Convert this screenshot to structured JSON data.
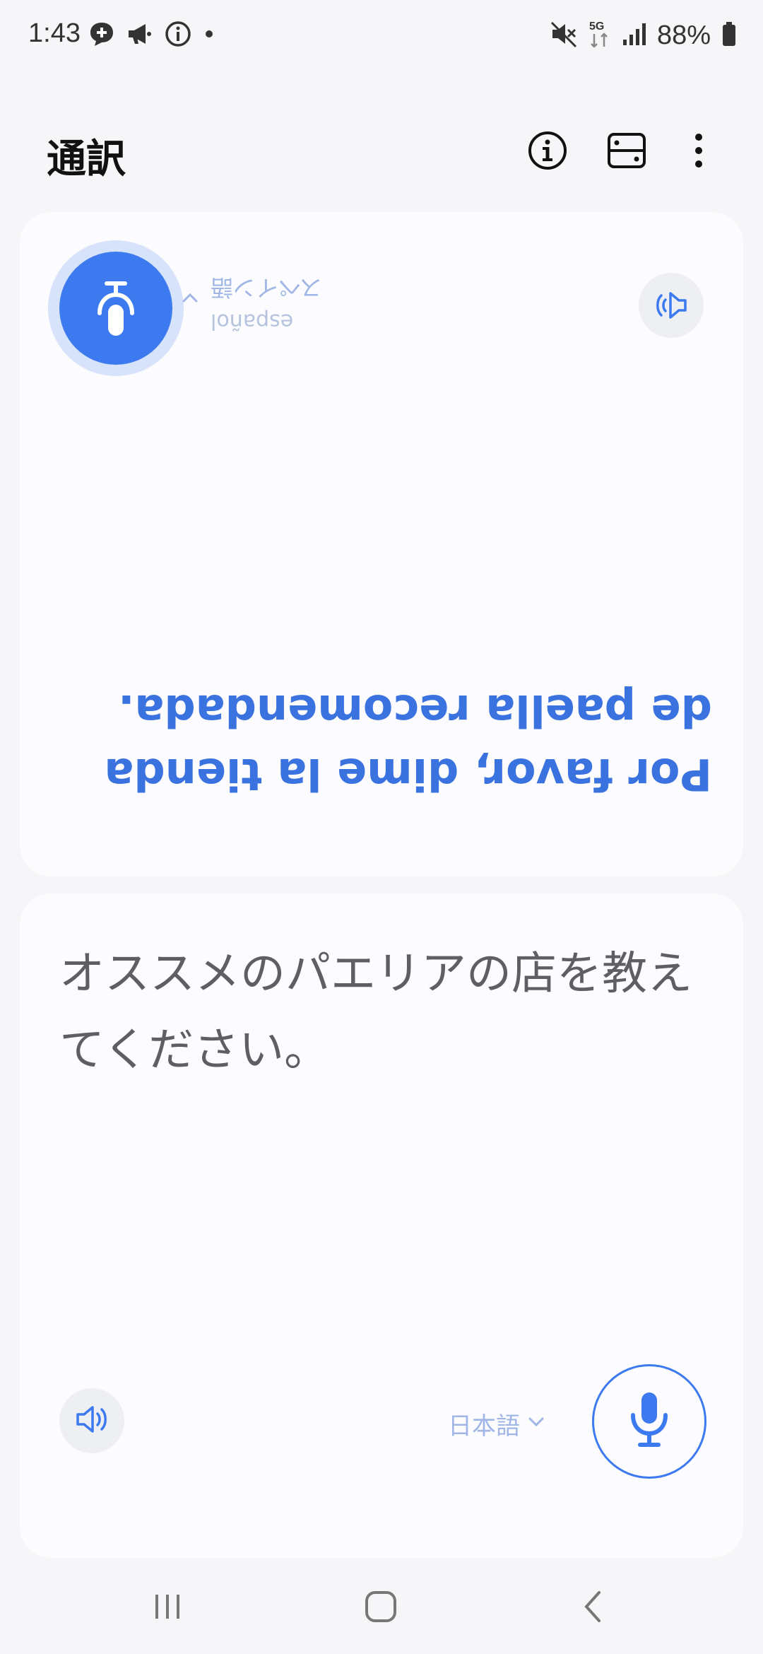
{
  "status_bar": {
    "time": "1:43",
    "battery": "88%",
    "network": "5G",
    "left_icons": [
      "chat-plus-icon",
      "megaphone-icon",
      "info-circle-icon",
      "dot-icon"
    ],
    "right_icons": [
      "mute-icon",
      "network-5g-icon",
      "signal-icon",
      "battery-icon"
    ]
  },
  "header": {
    "title": "通訳",
    "actions": [
      "info-icon",
      "layout-icon",
      "more-icon"
    ]
  },
  "partner_panel": {
    "language_main": "スペイン語",
    "language_sub": "español",
    "translation": "Por favor, dime la tienda de paella recomendada."
  },
  "own_panel": {
    "text": "オススメのパエリアの店を教えてください。",
    "language": "日本語"
  },
  "colors": {
    "accent": "#3d7af0",
    "partner_text": "#3a72e0",
    "lang_label": "#9fb6e6",
    "own_text": "#5f5f62",
    "card_bg": "#fcfcfe",
    "page_bg": "#f6f6f8"
  },
  "nav": {
    "buttons": [
      "recents-icon",
      "home-icon",
      "back-icon"
    ]
  }
}
